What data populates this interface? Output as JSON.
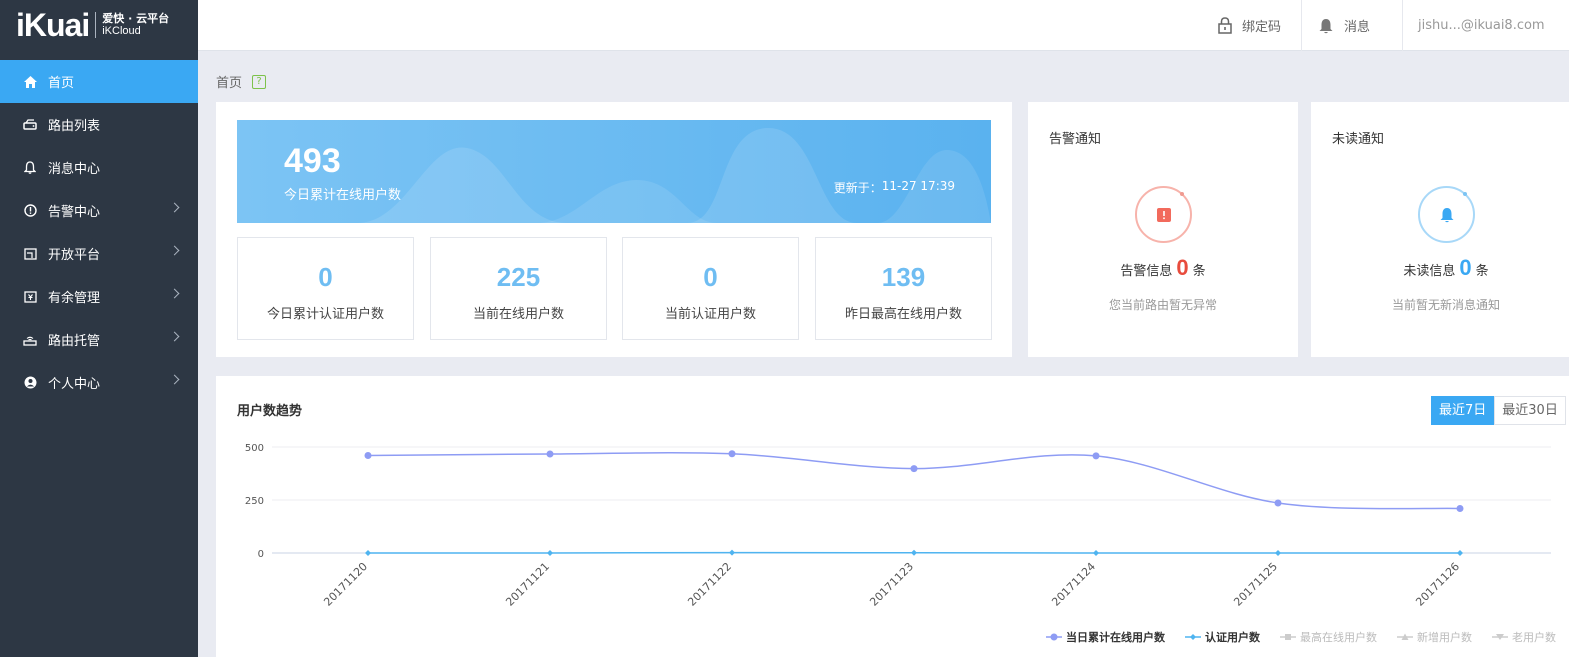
{
  "logo": {
    "brand": "iKuai",
    "line1": "爱快 · 云平台",
    "line2": "iKCloud"
  },
  "sidebar": {
    "items": [
      {
        "label": "首页",
        "icon": "home-icon",
        "active": true,
        "expandable": false
      },
      {
        "label": "路由列表",
        "icon": "router-icon",
        "active": false,
        "expandable": false
      },
      {
        "label": "消息中心",
        "icon": "bell-icon",
        "active": false,
        "expandable": false
      },
      {
        "label": "告警中心",
        "icon": "alert-icon",
        "active": false,
        "expandable": true
      },
      {
        "label": "开放平台",
        "icon": "screen-cast-icon",
        "active": false,
        "expandable": true
      },
      {
        "label": "有余管理",
        "icon": "money-icon",
        "active": false,
        "expandable": true
      },
      {
        "label": "路由托管",
        "icon": "wifi-router-icon",
        "active": false,
        "expandable": true
      },
      {
        "label": "个人中心",
        "icon": "user-icon",
        "active": false,
        "expandable": true
      }
    ]
  },
  "topbar": {
    "bind_label": "绑定码",
    "msg_label": "消息",
    "user_email": "jishu...@ikuai8.com"
  },
  "breadcrumb": {
    "current": "首页",
    "help": "?"
  },
  "hero": {
    "value": "493",
    "label": "今日累计在线用户数",
    "update_prefix": "更新于：",
    "update_time": "11-27 17:39"
  },
  "stats": [
    {
      "value": "0",
      "label": "今日累计认证用户数"
    },
    {
      "value": "225",
      "label": "当前在线用户数"
    },
    {
      "value": "0",
      "label": "当前认证用户数"
    },
    {
      "value": "139",
      "label": "昨日最高在线用户数"
    }
  ],
  "alarm": {
    "title": "告警通知",
    "prefix": "告警信息",
    "count": "0",
    "suffix": "条",
    "sub": "您当前路由暂无异常",
    "color": "#e84c3d"
  },
  "unread": {
    "title": "未读通知",
    "prefix": "未读信息",
    "count": "0",
    "suffix": "条",
    "sub": "当前暂无新消息通知",
    "color": "#3aa8f3"
  },
  "trend": {
    "title": "用户数趋势",
    "range_7": "最近7日",
    "range_30": "最近30日",
    "selected": "最近7日"
  },
  "chart_data": {
    "type": "line",
    "categories": [
      "20171120",
      "20171121",
      "20171122",
      "20171123",
      "20171124",
      "20171125",
      "20171126"
    ],
    "ylim": [
      0,
      500
    ],
    "yticks": [
      0,
      250,
      500
    ],
    "grid": true,
    "legend_position": "bottom-right",
    "series": [
      {
        "name": "当日累计在线用户数",
        "values": [
          460,
          467,
          468,
          398,
          458,
          236,
          210
        ],
        "color": "#8e9cf4",
        "visible": true
      },
      {
        "name": "认证用户数",
        "values": [
          0,
          0,
          2,
          1,
          0,
          0,
          0
        ],
        "color": "#4fb4f0",
        "visible": true
      },
      {
        "name": "最高在线用户数",
        "values": [],
        "color": "#cccccc",
        "visible": false
      },
      {
        "name": "新增用户数",
        "values": [],
        "color": "#cccccc",
        "visible": false
      },
      {
        "name": "老用户数",
        "values": [],
        "color": "#cccccc",
        "visible": false
      }
    ]
  }
}
